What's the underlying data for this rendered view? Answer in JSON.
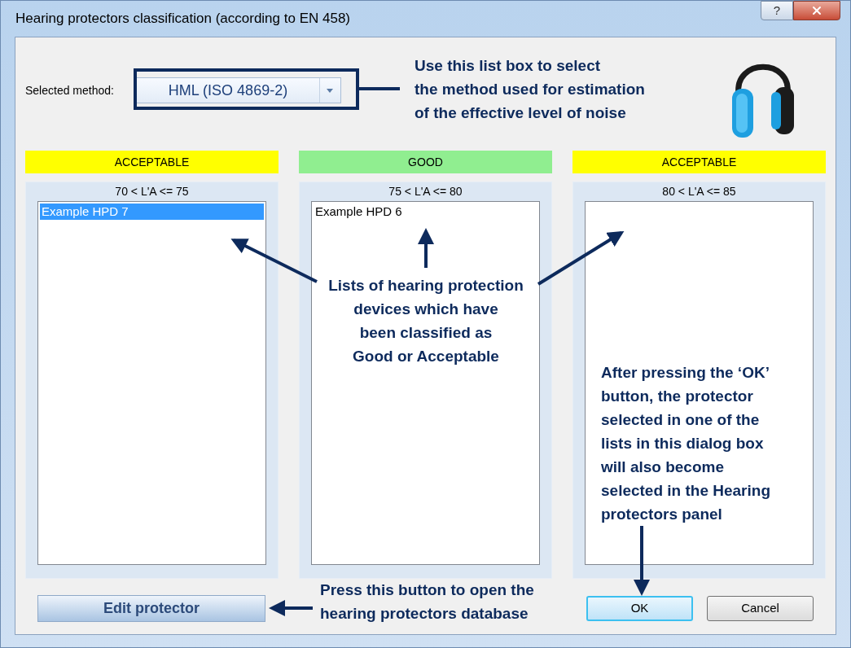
{
  "window": {
    "title": "Hearing protectors classification (according to EN 458)",
    "help_button": "?"
  },
  "method": {
    "label": "Selected method:",
    "value": "HML (ISO 4869-2)"
  },
  "columns": [
    {
      "rating": "ACCEPTABLE",
      "color": "#ffff00",
      "range": "70 < L'A <= 75",
      "items": [
        {
          "label": "Example HPD 7",
          "selected": true
        }
      ]
    },
    {
      "rating": "GOOD",
      "color": "#90ee90",
      "range": "75 < L'A <= 80",
      "items": [
        {
          "label": "Example HPD 6",
          "selected": false
        }
      ]
    },
    {
      "rating": "ACCEPTABLE",
      "color": "#ffff00",
      "range": "80 < L'A <= 85"
    }
  ],
  "buttons": [
    {
      "kind": "edit",
      "label": "Edit protector",
      "focused": false
    },
    {
      "kind": "dialog",
      "label": "OK",
      "focused": true
    },
    {
      "kind": "dialog",
      "label": "Cancel",
      "focused": false
    }
  ],
  "annotations": [
    {
      "lines": [
        "Use this list box to select",
        "the method used for estimation",
        "of the effective level of noise"
      ]
    },
    {
      "lines": [
        "Lists of hearing protection",
        "devices which have",
        "been classified as",
        "Good or Acceptable"
      ]
    },
    {
      "lines": [
        "After pressing the ‘OK’",
        "button, the protector",
        "selected in one of the",
        "lists in this dialog box",
        "will also become",
        "selected in the Hearing",
        "protectors panel"
      ]
    },
    {
      "lines": [
        "Press this button to open the",
        "hearing protectors database"
      ]
    }
  ]
}
